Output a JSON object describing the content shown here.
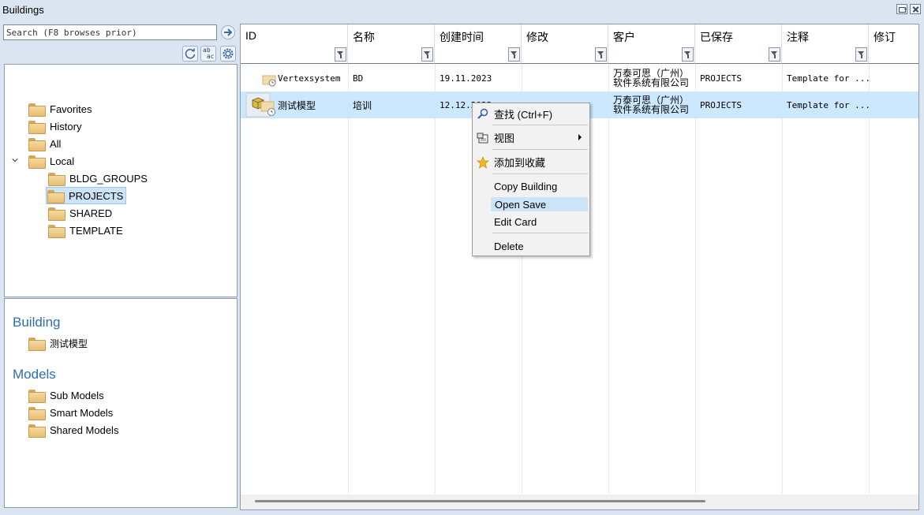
{
  "window": {
    "title": "Buildings"
  },
  "search": {
    "placeholder": "Search (F8 browses prior)",
    "value": ""
  },
  "toolbar": {
    "refresh_icon": "refresh-icon",
    "case_icon_label": "ab\nac",
    "settings_icon": "gear-icon"
  },
  "tree": {
    "items": [
      {
        "label": "Favorites"
      },
      {
        "label": "History"
      },
      {
        "label": "All"
      },
      {
        "label": "Local"
      },
      {
        "label": "BLDG_GROUPS"
      },
      {
        "label": "PROJECTS"
      },
      {
        "label": "SHARED"
      },
      {
        "label": "TEMPLATE"
      }
    ]
  },
  "info": {
    "building_title": "Building",
    "building_name": "测试模型",
    "models_title": "Models",
    "models": [
      {
        "label": "Sub Models"
      },
      {
        "label": "Smart Models"
      },
      {
        "label": "Shared Models"
      }
    ]
  },
  "grid": {
    "columns": [
      "ID",
      "名称",
      "创建时间",
      "修改",
      "客户",
      "已保存",
      "注释",
      "修订"
    ],
    "rows": [
      {
        "id": "Vertexsystem",
        "name": "BD",
        "created": "19.11.2023",
        "modified": "",
        "client": "万泰可思（广州）软件系统有限公司",
        "saved": "PROJECTS",
        "comment": "Template for ...",
        "revision": ""
      },
      {
        "id": "测试模型",
        "name": "培训",
        "created": "12.12.2023",
        "modified": "",
        "client": "万泰可思（广州）软件系统有限公司",
        "saved": "PROJECTS",
        "comment": "Template for ...",
        "revision": ""
      }
    ]
  },
  "context_menu": {
    "items": [
      {
        "label": "查找 (Ctrl+F)",
        "icon": "search-icon"
      },
      {
        "label": "视图",
        "icon": "view-icon"
      },
      {
        "label": "添加到收藏",
        "icon": "star-icon"
      },
      {
        "label": "Copy Building"
      },
      {
        "label": "Open Save"
      },
      {
        "label": "Edit Card"
      },
      {
        "label": "Delete"
      }
    ]
  }
}
